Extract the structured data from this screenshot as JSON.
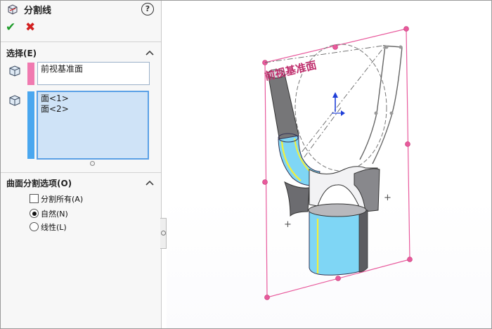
{
  "panel": {
    "title": "分割线",
    "help_icon": "question-circle-icon",
    "feature_icon": "split-line-icon",
    "ok_icon": "checkmark-icon",
    "cancel_icon": "close-x-icon",
    "selection": {
      "title": "选择(E)",
      "plane_field": {
        "value": "前视基准面",
        "swatch_color": "#f07ab0",
        "icon": "plane-cube-icon"
      },
      "faces_field": {
        "items": [
          "面<1>",
          "面<2>"
        ],
        "swatch_color": "#4aa7ef",
        "icon": "face-cube-icon"
      }
    },
    "options": {
      "title": "曲面分割选项(O)",
      "split_all": {
        "label": "分割所有(A)",
        "checked": false
      },
      "natural": {
        "label": "自然(N)",
        "selected": true
      },
      "linear": {
        "label": "线性(L)",
        "selected": false
      }
    }
  },
  "viewport": {
    "plane_label": "前视基准面",
    "plane_color": "#e8599c",
    "surface_color": "#7fd6f5",
    "highlight_color": "#f3f03a"
  }
}
